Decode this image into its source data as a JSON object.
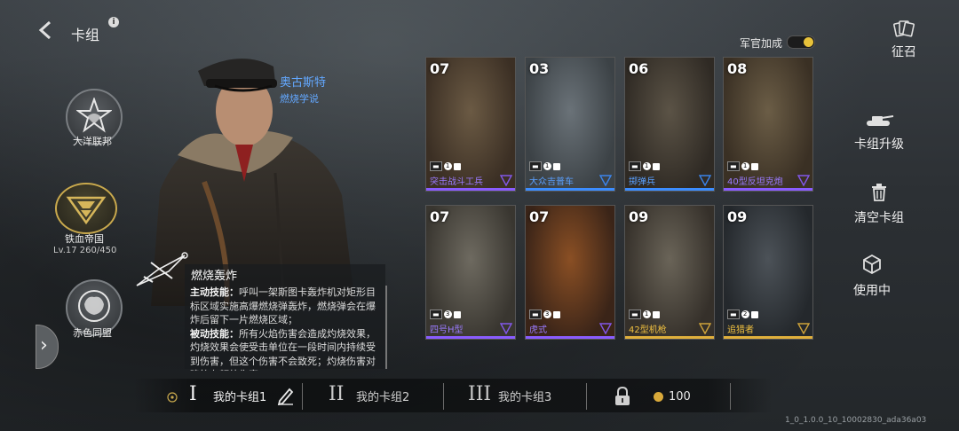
{
  "header": {
    "title": "卡组",
    "recruit_label": "征召",
    "officer_bonus_label": "军官加成",
    "officer_bonus_on": true
  },
  "factions": [
    {
      "name": "大洋联邦"
    },
    {
      "name": "铁血帝国",
      "level": "Lv.17  260/450",
      "selected": true
    },
    {
      "name": "赤色同盟"
    }
  ],
  "general": {
    "name": "奥古斯特",
    "doctrine": "燃烧学说"
  },
  "skill": {
    "name": "燃烧轰炸",
    "active_label": "主动技能：",
    "active_text": "呼叫一架斯图卡轰炸机对矩形目标区域实施高爆燃烧弹轰炸，燃烧弹会在爆炸后留下一片燃烧区域；",
    "passive_label": "被动技能：",
    "passive_text": "所有火焰伤害会造成灼烧效果，灼烧效果会使受击单位在一段时间内持续受到伤害，但这个伤害不会致死；灼烧伤害对建筑有额外伤害。"
  },
  "cards": [
    {
      "cost": "07",
      "name": "突击战斗工兵",
      "count": "1",
      "rarity": "purple",
      "rarity_color": "#8a5cff",
      "name_color": "#9b7bff"
    },
    {
      "cost": "03",
      "name": "大众吉普车",
      "count": "1",
      "rarity": "blue",
      "rarity_color": "#3c8dff",
      "name_color": "#5aa0ff"
    },
    {
      "cost": "06",
      "name": "掷弹兵",
      "count": "1",
      "rarity": "blue",
      "rarity_color": "#3c8dff",
      "name_color": "#5aa0ff"
    },
    {
      "cost": "08",
      "name": "40型反坦克炮",
      "count": "1",
      "rarity": "purple",
      "rarity_color": "#8a5cff",
      "name_color": "#9b7bff"
    },
    {
      "cost": "07",
      "name": "四号H型",
      "count": "3",
      "rarity": "purple",
      "rarity_color": "#8a5cff",
      "name_color": "#9b7bff"
    },
    {
      "cost": "07",
      "name": "虎式",
      "count": "3",
      "rarity": "purple",
      "rarity_color": "#8a5cff",
      "name_color": "#9b7bff"
    },
    {
      "cost": "09",
      "name": "42型机枪",
      "count": "1",
      "rarity": "gold",
      "rarity_color": "#e0b03c",
      "name_color": "#f0c040"
    },
    {
      "cost": "09",
      "name": "追猎者",
      "count": "2",
      "rarity": "gold",
      "rarity_color": "#e0b03c",
      "name_color": "#f0c040"
    }
  ],
  "actions": {
    "upgrade": "卡组升级",
    "clear": "清空卡组",
    "in_use": "使用中"
  },
  "decks": [
    {
      "roman": "I",
      "name": "我的卡组1",
      "active": true
    },
    {
      "roman": "II",
      "name": "我的卡组2"
    },
    {
      "roman": "III",
      "name": "我的卡组3"
    }
  ],
  "currency": {
    "value": "100"
  },
  "version": "1_0_1.0.0_10_10002830_ada36a03"
}
